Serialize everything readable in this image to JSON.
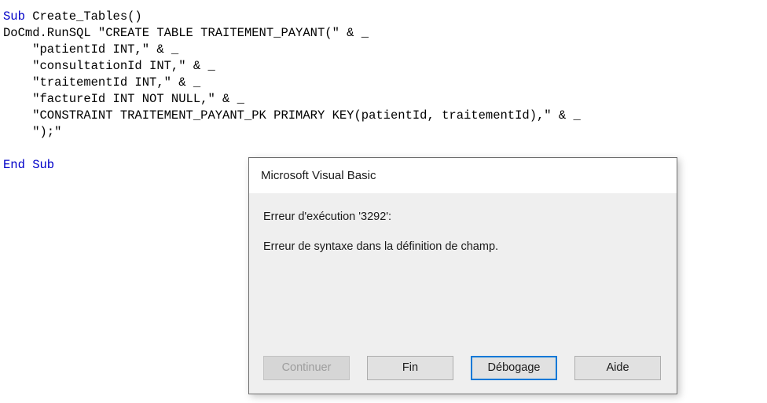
{
  "editor": {
    "language": "VBA",
    "keyword_color": "#0000c8",
    "text_color": "#000000",
    "background": "#ffffff",
    "lines": [
      {
        "id": "line-1",
        "segments": [
          {
            "t": "Sub",
            "kw": true
          },
          {
            "t": " Create_Tables()",
            "kw": false
          }
        ]
      },
      {
        "id": "line-2",
        "segments": [
          {
            "t": "DoCmd.RunSQL \"CREATE TABLE TRAITEMENT_PAYANT(\" & _",
            "kw": false
          }
        ]
      },
      {
        "id": "line-3",
        "segments": [
          {
            "t": "    \"patientId INT,\" & _",
            "kw": false
          }
        ]
      },
      {
        "id": "line-4",
        "segments": [
          {
            "t": "    \"consultationId INT,\" & _",
            "kw": false
          }
        ]
      },
      {
        "id": "line-5",
        "segments": [
          {
            "t": "    \"traitementId INT,\" & _",
            "kw": false
          }
        ]
      },
      {
        "id": "line-6",
        "segments": [
          {
            "t": "    \"factureId INT NOT NULL,\" & _",
            "kw": false
          }
        ]
      },
      {
        "id": "line-7",
        "segments": [
          {
            "t": "    \"CONSTRAINT TRAITEMENT_PAYANT_PK PRIMARY KEY(patientId, traitementId),\" & _",
            "kw": false
          }
        ]
      },
      {
        "id": "line-8",
        "segments": [
          {
            "t": "    \");\"",
            "kw": false
          }
        ]
      },
      {
        "id": "line-9",
        "segments": [
          {
            "t": "",
            "kw": false
          }
        ]
      },
      {
        "id": "line-10",
        "segments": [
          {
            "t": "End Sub",
            "kw": true
          }
        ]
      }
    ]
  },
  "dialog": {
    "title": "Microsoft Visual Basic",
    "message_line_1": "Erreur d'exécution '3292':",
    "message_line_2": "Erreur de syntaxe dans la définition de champ.",
    "focus_color": "#0078d7",
    "background": "#efefef",
    "titlebar_background": "#ffffff",
    "buttons": [
      {
        "id": "continuer",
        "label": "Continuer",
        "state": "disabled"
      },
      {
        "id": "fin",
        "label": "Fin",
        "state": "enabled"
      },
      {
        "id": "debogage",
        "label": "Débogage",
        "state": "focused"
      },
      {
        "id": "aide",
        "label": "Aide",
        "state": "enabled"
      }
    ]
  }
}
